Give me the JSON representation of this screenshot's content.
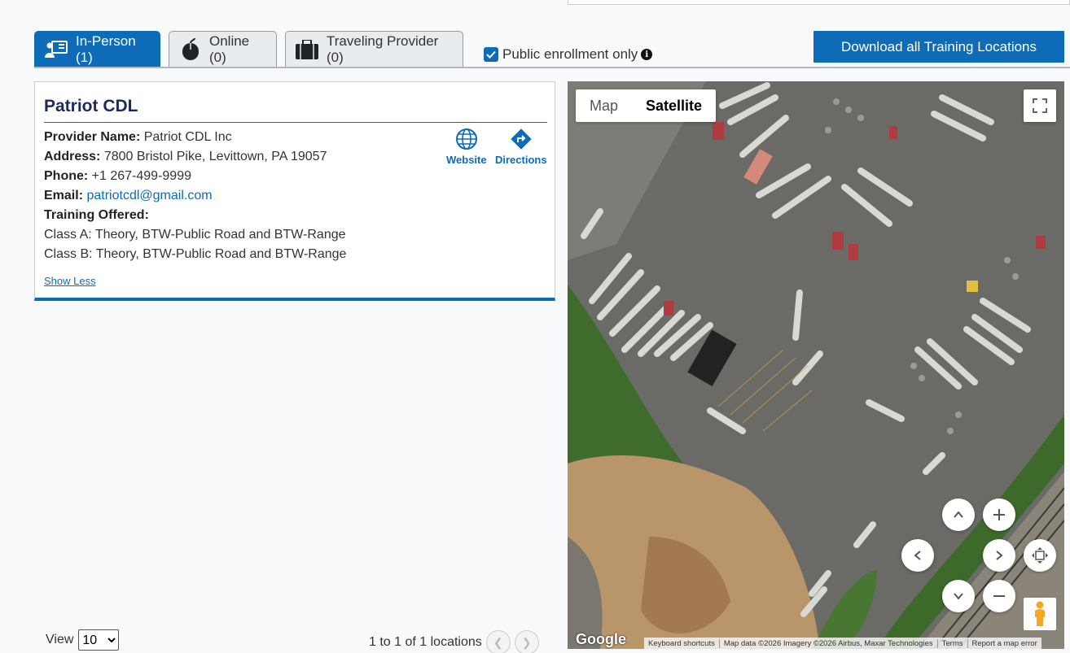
{
  "tabs": [
    {
      "label": "In-Person (1)",
      "icon": "person-card-icon",
      "active": true
    },
    {
      "label": "Online (0)",
      "icon": "mouse-icon",
      "active": false
    },
    {
      "label": "Traveling Provider (0)",
      "icon": "briefcase-icon",
      "active": false
    }
  ],
  "enrollment": {
    "label": "Public enrollment only",
    "checked": true,
    "icon": "info-icon"
  },
  "download_button": "Download all Training Locations",
  "provider": {
    "title": "Patriot CDL",
    "name_label": "Provider Name:",
    "name": "Patriot CDL Inc",
    "address_label": "Address:",
    "address": "7800 Bristol Pike, Levittown, PA 19057",
    "phone_label": "Phone:",
    "phone": "+1 267-499-9999",
    "email_label": "Email:",
    "email": "patriotcdl@gmail.com",
    "training_label": "Training Offered:",
    "training": [
      "Class A: Theory, BTW-Public Road and BTW-Range",
      "Class B: Theory, BTW-Public Road and BTW-Range"
    ],
    "website_label": "Website",
    "directions_label": "Directions",
    "show_less": "Show Less"
  },
  "pagination": {
    "view_label": "View",
    "page_size": "10",
    "summary": "1 to 1 of 1 locations"
  },
  "map": {
    "type_options": [
      "Map",
      "Satellite"
    ],
    "selected_type": "Satellite",
    "logo": "Google",
    "attribution": [
      "Keyboard shortcuts",
      "Map data ©2026 Imagery ©2026 Airbus, Maxar Technologies",
      "Terms",
      "Report a map error"
    ]
  },
  "colors": {
    "primary": "#0e6bb8",
    "title": "#1f2a5c"
  }
}
